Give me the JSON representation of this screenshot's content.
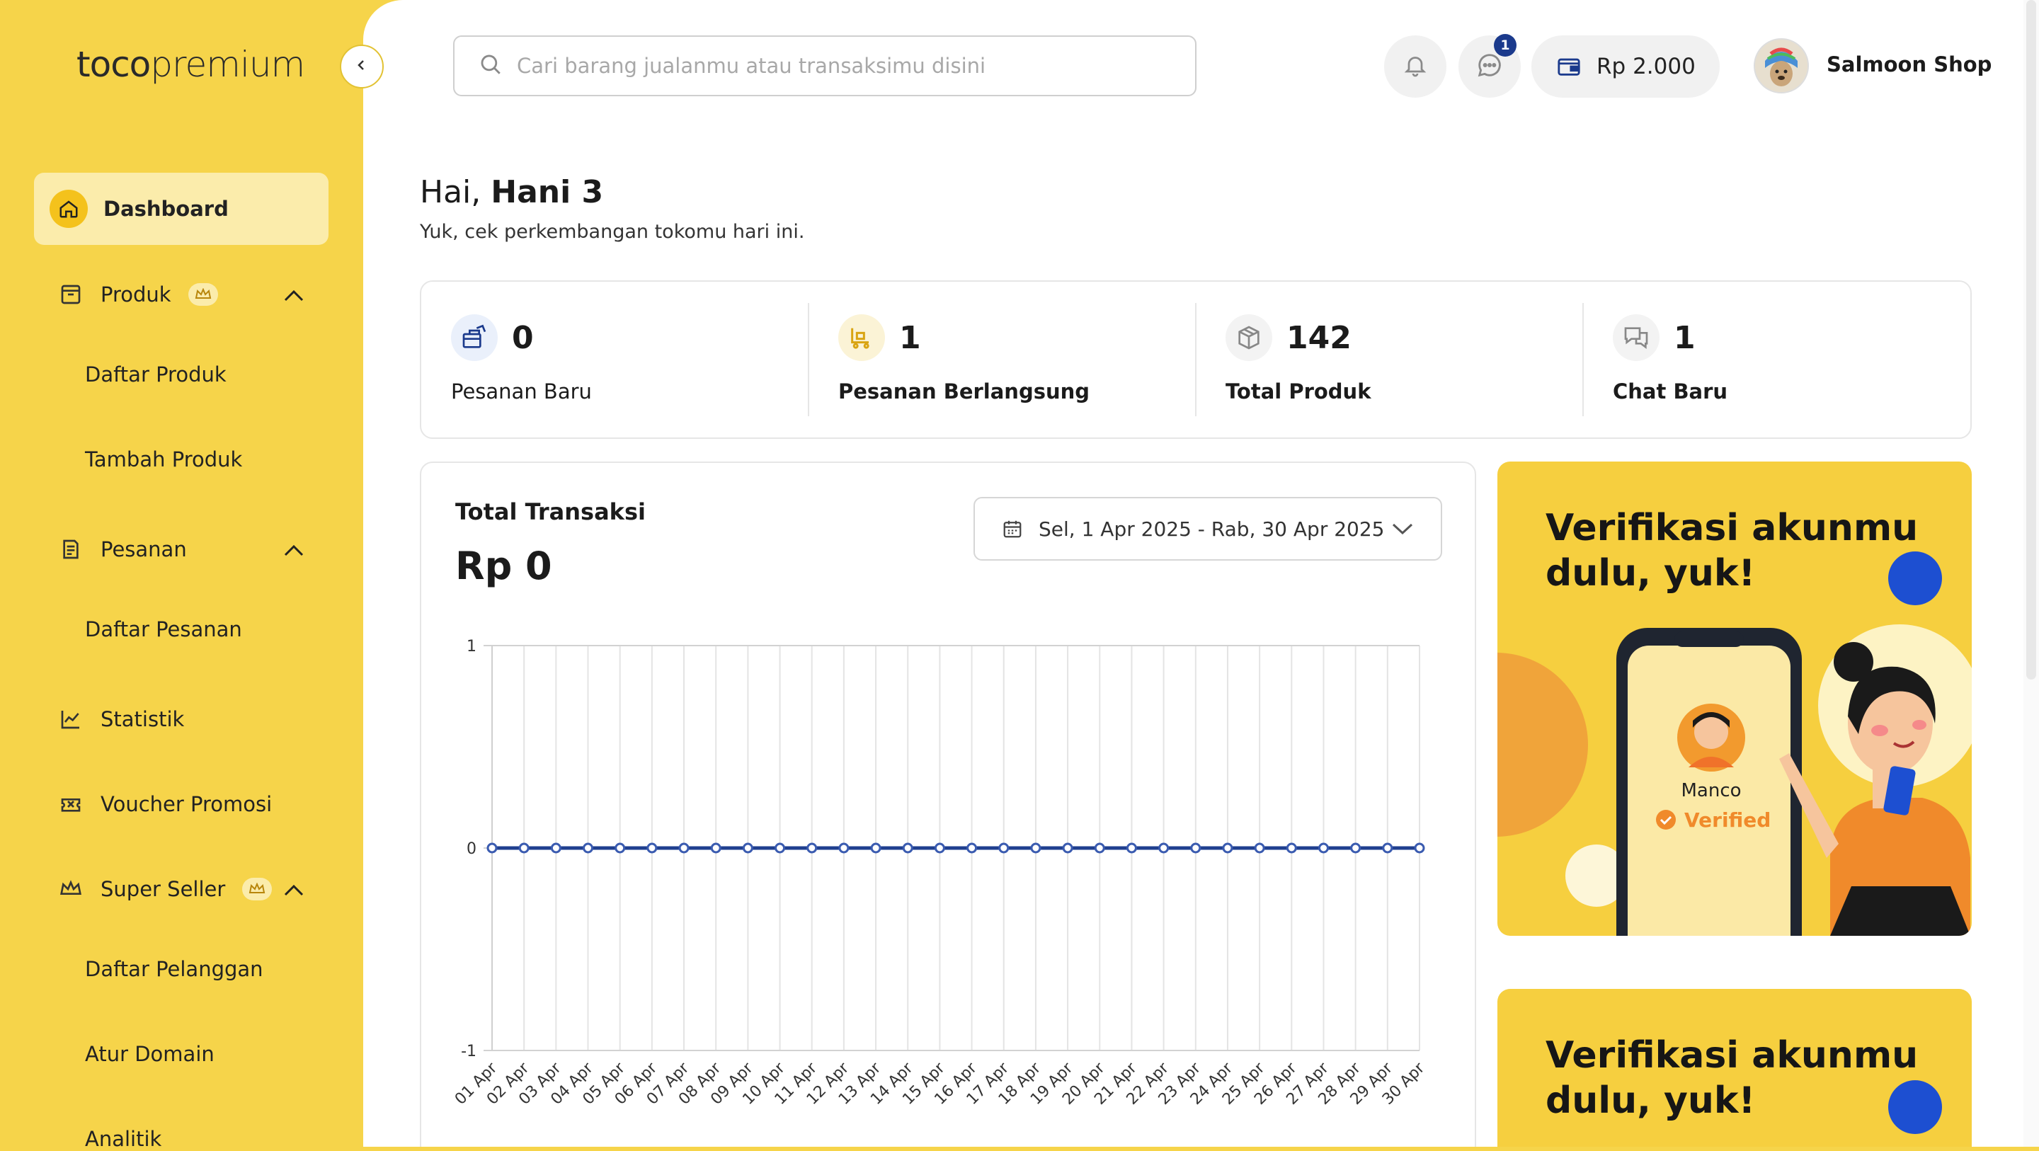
{
  "brand": {
    "logo_part1": "toco",
    "logo_part2": "premium"
  },
  "sidebar": {
    "items": [
      {
        "label": "Dashboard"
      },
      {
        "label": "Produk"
      },
      {
        "label": "Pesanan"
      },
      {
        "label": "Statistik"
      },
      {
        "label": "Voucher Promosi"
      },
      {
        "label": "Super Seller"
      }
    ],
    "sub_items": {
      "produk": [
        "Daftar Produk",
        "Tambah Produk"
      ],
      "pesanan": [
        "Daftar Pesanan"
      ],
      "super_seller": [
        "Daftar Pelanggan",
        "Atur Domain",
        "Analitik"
      ]
    }
  },
  "header": {
    "search_placeholder": "Cari barang jualanmu atau transaksimu disini",
    "chat_badge": "1",
    "wallet_balance": "Rp 2.000",
    "shop_name": "Salmoon Shop"
  },
  "greeting": {
    "prefix": "Hai,",
    "name": "Hani 3",
    "subtitle": "Yuk, cek perkembangan tokomu hari ini."
  },
  "stats": [
    {
      "value": "0",
      "label": "Pesanan Baru",
      "icon": "box-arrow-icon"
    },
    {
      "value": "1",
      "label": "Pesanan Berlangsung",
      "icon": "cart-icon"
    },
    {
      "value": "142",
      "label": "Total Produk",
      "icon": "package-icon"
    },
    {
      "value": "1",
      "label": "Chat Baru",
      "icon": "chat-icon"
    }
  ],
  "transactions": {
    "title": "Total Transaksi",
    "total": "Rp 0",
    "date_range": "Sel, 1 Apr 2025 - Rab, 30 Apr 2025"
  },
  "chart_data": {
    "type": "line",
    "x": [
      "01 Apr",
      "02 Apr",
      "03 Apr",
      "04 Apr",
      "05 Apr",
      "06 Apr",
      "07 Apr",
      "08 Apr",
      "09 Apr",
      "10 Apr",
      "11 Apr",
      "12 Apr",
      "13 Apr",
      "14 Apr",
      "15 Apr",
      "16 Apr",
      "17 Apr",
      "18 Apr",
      "19 Apr",
      "20 Apr",
      "21 Apr",
      "22 Apr",
      "23 Apr",
      "24 Apr",
      "25 Apr",
      "26 Apr",
      "27 Apr",
      "28 Apr",
      "29 Apr",
      "30 Apr"
    ],
    "series": [
      {
        "values": [
          0,
          0,
          0,
          0,
          0,
          0,
          0,
          0,
          0,
          0,
          0,
          0,
          0,
          0,
          0,
          0,
          0,
          0,
          0,
          0,
          0,
          0,
          0,
          0,
          0,
          0,
          0,
          0,
          0,
          0
        ]
      }
    ],
    "y_ticks": [
      "1",
      "0",
      "-1"
    ],
    "ylim": [
      -1,
      1
    ],
    "grid": true,
    "line_color": "#1f3f8f"
  },
  "promos": [
    {
      "title_line1": "Verifikasi akunmu",
      "title_line2": "dulu, yuk!",
      "card_name": "Manco",
      "card_status": "Verified"
    },
    {
      "title_line1": "Verifikasi akunmu",
      "title_line2": "dulu, yuk!"
    }
  ],
  "colors": {
    "sidebar": "#f6d44a",
    "active_item": "#fbecab",
    "accent_blue": "#1d4fd1",
    "orange": "#f08a2b"
  }
}
